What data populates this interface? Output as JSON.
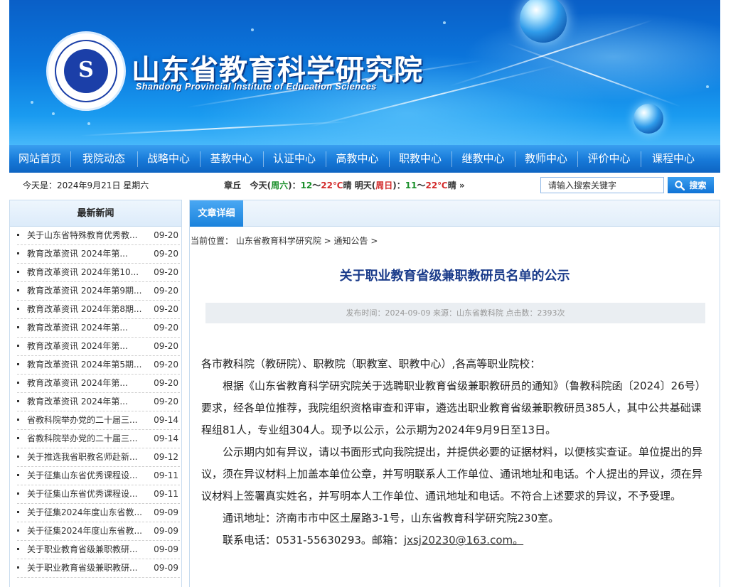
{
  "site": {
    "title_cn": "山东省教育科学研究院",
    "title_en": "Shandong Provincial Institute of Education Sciences"
  },
  "nav": [
    "网站首页",
    "我院动态",
    "战略中心",
    "基教中心",
    "认证中心",
    "高教中心",
    "职教中心",
    "继教中心",
    "教师中心",
    "评价中心",
    "课程中心"
  ],
  "infobar": {
    "date": "今天是：2024年9月21日 星期六",
    "weather": {
      "city": "章丘",
      "today_label": "今天",
      "today_day": "周六",
      "today_low": "12",
      "today_high": "22",
      "today_cond": "晴",
      "tomorrow_label": "明天",
      "tomorrow_day": "周日",
      "tomorrow_low": "11",
      "tomorrow_high": "22",
      "tomorrow_cond": "晴"
    },
    "search_placeholder": "请输入搜索关键字",
    "search_button": "搜索"
  },
  "sidebar": {
    "heading": "最新新闻",
    "items": [
      {
        "title": "关于山东省特殊教育优秀教...",
        "date": "09-20"
      },
      {
        "title": "教育改革资讯  2024年第...",
        "date": "09-20"
      },
      {
        "title": "教育改革资讯  2024年第10...",
        "date": "09-20"
      },
      {
        "title": "教育改革资讯  2024年第9期...",
        "date": "09-20"
      },
      {
        "title": "教育改革资讯  2024年第8期...",
        "date": "09-20"
      },
      {
        "title": "教育改革资讯  2024年第...",
        "date": "09-20"
      },
      {
        "title": "教育改革资讯  2024年第...",
        "date": "09-20"
      },
      {
        "title": "教育改革资讯  2024年第5期...",
        "date": "09-20"
      },
      {
        "title": "教育改革资讯  2024年第...",
        "date": "09-20"
      },
      {
        "title": "教育改革资讯  2024年第...",
        "date": "09-20"
      },
      {
        "title": "省教科院举办党的二十届三...",
        "date": "09-14"
      },
      {
        "title": "省教科院举办党的二十届三...",
        "date": "09-14"
      },
      {
        "title": "关于推选我省职教名师赴新...",
        "date": "09-12"
      },
      {
        "title": "关于征集山东省优秀课程设...",
        "date": "09-11"
      },
      {
        "title": "关于征集山东省优秀课程设...",
        "date": "09-11"
      },
      {
        "title": "关于征集2024年度山东省教...",
        "date": "09-09"
      },
      {
        "title": "关于征集2024年度山东省教...",
        "date": "09-09"
      },
      {
        "title": "关于职业教育省级兼职教研...",
        "date": "09-09"
      },
      {
        "title": "关于职业教育省级兼职教研...",
        "date": "09-09"
      }
    ]
  },
  "main": {
    "tab": "文章详细",
    "crumb_prefix": "当前位置：",
    "crumb_1": "山东省教育科学研究院",
    "crumb_sep": " > ",
    "crumb_2": "通知公告",
    "crumb_end": " >",
    "title": "关于职业教育省级兼职教研员名单的公示",
    "meta": "发布时间：2024-09-09 来源：山东省教科院 点击数：2393次",
    "salutation": "各市教科院（教研院）、职教院（职教室、职教中心）,各高等职业院校：",
    "para1": "根据《山东省教育科学研究院关于选聘职业教育省级兼职教研员的通知》（鲁教科院函〔2024〕26号）要求，经各单位推荐，我院组织资格审查和评审，遴选出职业教育省级兼职教研员385人，其中公共基础课程组81人，专业组304人。现予以公示，公示期为2024年9月9日至13日。",
    "para2": "公示期内如有异议，请以书面形式向我院提出，并提供必要的证据材料，以便核实查证。单位提出的异议，须在异议材料上加盖本单位公章，并写明联系人工作单位、通讯地址和电话。个人提出的异议，须在异议材料上签署真实姓名，并写明本人工作单位、通讯地址和电话。不符合上述要求的异议，不予受理。",
    "address": "通讯地址：济南市市中区土屋路3-1号，山东省教育科学研究院230室。",
    "phone": "联系电话：0531-55630293。邮箱：",
    "email": "jxsj20230@163.com。"
  }
}
